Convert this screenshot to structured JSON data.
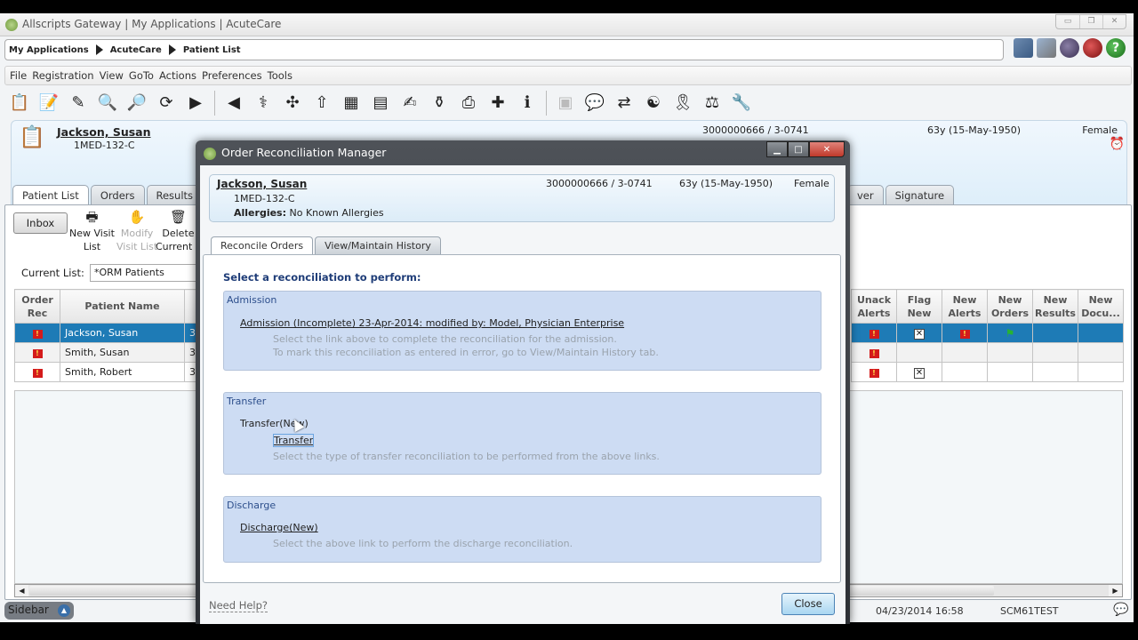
{
  "window": {
    "title": "Allscripts Gateway | My Applications | AcuteCare",
    "controls": [
      "minimize",
      "restore",
      "close"
    ]
  },
  "breadcrumb": [
    "My Applications",
    "AcuteCare",
    "Patient List"
  ],
  "system_icons": [
    "remote-desktop-icon",
    "settings-tools-icon",
    "sleep-icon",
    "power-icon",
    "help-icon"
  ],
  "menu": [
    "File",
    "Registration",
    "View",
    "GoTo",
    "Actions",
    "Preferences",
    "Tools"
  ],
  "toolbar": [
    {
      "name": "patient-camera-icon",
      "glyph": "📋"
    },
    {
      "name": "clipboard-edit-icon",
      "glyph": "📝"
    },
    {
      "name": "document-edit-icon",
      "glyph": "✎"
    },
    {
      "name": "patient-search-icon",
      "glyph": "🔍"
    },
    {
      "name": "records-search-icon",
      "glyph": "🔎"
    },
    {
      "name": "refresh-icon",
      "glyph": "⟳"
    },
    {
      "name": "forward-patient-icon",
      "glyph": "▶"
    },
    {
      "name": "back-patient-icon",
      "glyph": "◀"
    },
    {
      "name": "caduceus-icon",
      "glyph": "⚕"
    },
    {
      "name": "signpost-icon",
      "glyph": "✣"
    },
    {
      "name": "person-arrow-icon",
      "glyph": "⇧"
    },
    {
      "name": "flowsheet-icon",
      "glyph": "▦"
    },
    {
      "name": "flowsheet-search-icon",
      "glyph": "▤"
    },
    {
      "name": "form-edit-icon",
      "glyph": "✍"
    },
    {
      "name": "medication-bottle-icon",
      "glyph": "⚱"
    },
    {
      "name": "printer-icon",
      "glyph": "⎙"
    },
    {
      "name": "add-provider-icon",
      "glyph": "✚"
    },
    {
      "name": "patient-info-icon",
      "glyph": "ℹ"
    },
    {
      "name": "disabled-tool-icon",
      "glyph": "▣"
    },
    {
      "name": "pill-message-icon",
      "glyph": "💬"
    },
    {
      "name": "reconcile-arrows-icon",
      "glyph": "⇄"
    },
    {
      "name": "yin-yang-icon",
      "glyph": "☯"
    },
    {
      "name": "ribbon-list-icon",
      "glyph": "🎗"
    },
    {
      "name": "scales-icon",
      "glyph": "⚖"
    },
    {
      "name": "tools-icon",
      "glyph": "🔧"
    }
  ],
  "patient": {
    "name": "Jackson, Susan",
    "location": "1MED-132-C",
    "mrn": "3000000666 / 3-0741",
    "age": "63y (15-May-1950)",
    "sex": "Female",
    "allergies_label": "Allergies:",
    "allergies": "No Known Allergies"
  },
  "main_tabs": {
    "left": [
      "Patient List",
      "Orders",
      "Results"
    ],
    "right_partial": [
      "ver",
      "Signature"
    ],
    "active": "Patient List"
  },
  "list_actions": {
    "inbox": "Inbox",
    "new_visit_list": [
      "New Visit",
      "List"
    ],
    "modify_visit_list": [
      "Modify",
      "Visit List"
    ],
    "delete_current_list": [
      "Delete",
      "Current L"
    ]
  },
  "current_list": {
    "label": "Current List:",
    "value": "*ORM Patients"
  },
  "grid": {
    "left_columns": [
      [
        "Order",
        "Rec"
      ],
      [
        "Patient Name"
      ]
    ],
    "right_columns": [
      [
        "Unack",
        "Alerts"
      ],
      [
        "Flag",
        "New"
      ],
      [
        "New",
        "Alerts"
      ],
      [
        "New",
        "Orders"
      ],
      [
        "New",
        "Results"
      ],
      [
        "New",
        "Docu..."
      ]
    ],
    "rows": [
      {
        "order_rec": "flag",
        "name": "Jackson, Susan",
        "col3": "3",
        "unack_alerts": "flag",
        "flag_new": "checked",
        "new_alerts": "flag",
        "new_orders": "green-flag",
        "new_results": "",
        "new_docu": "",
        "selected": true
      },
      {
        "order_rec": "flag",
        "name": "Smith, Susan",
        "col3": "3",
        "unack_alerts": "flag",
        "flag_new": "",
        "new_alerts": "",
        "new_orders": "",
        "new_results": "",
        "new_docu": "",
        "selected": false
      },
      {
        "order_rec": "flag",
        "name": "Smith, Robert",
        "col3": "3",
        "unack_alerts": "flag",
        "flag_new": "checked",
        "new_alerts": "",
        "new_orders": "",
        "new_results": "",
        "new_docu": "",
        "selected": false
      }
    ]
  },
  "status_bar": {
    "sidebar": "Sidebar",
    "datetime": "04/23/2014 16:58",
    "user": "SCM61TEST"
  },
  "modal": {
    "title": "Order Reconciliation Manager",
    "tabs": [
      "Reconcile Orders",
      "View/Maintain History"
    ],
    "active_tab": "Reconcile Orders",
    "heading": "Select a reconciliation to perform:",
    "sections": {
      "admission": {
        "title": "Admission",
        "link": "Admission (Incomplete) 23-Apr-2014: modified by: Model, Physician Enterprise",
        "hint1": "Select the link above to complete the reconciliation for the admission.",
        "hint2": "To mark this reconciliation as entered in error, go to View/Maintain History tab."
      },
      "transfer": {
        "title": "Transfer",
        "label": "Transfer(New)",
        "link": "Transfer",
        "hint": "Select the type of transfer reconciliation to be performed from the above links."
      },
      "discharge": {
        "title": "Discharge",
        "link": "Discharge(New)",
        "hint": "Select the above link to perform the discharge reconciliation."
      }
    },
    "need_help": "Need Help?",
    "close": "Close"
  },
  "colors": {
    "selected_row": "#1e7bb6",
    "section_bg": "#cddcf3",
    "heading": "#1f3d78",
    "flag_red": "#d41b1b"
  }
}
